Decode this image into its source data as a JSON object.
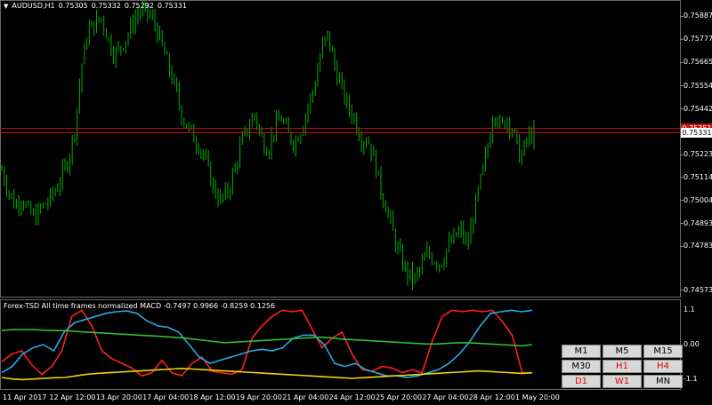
{
  "symbol": {
    "label": "AUDUSD,H1",
    "open": "0.75305",
    "high": "0.75332",
    "low": "0.75292",
    "close": "0.75331"
  },
  "indicator": {
    "label": "Forex-TSD All time frames normalized MACD -0.7497 0.9966 -0.8259 0.1256"
  },
  "price_axis": {
    "ticks": [
      "0.75887",
      "0.75777",
      "0.75665",
      "0.75554",
      "0.75442",
      "0.75223",
      "0.75114",
      "0.75004",
      "0.74893",
      "0.74783",
      "0.74573"
    ],
    "current_price": "0.75331",
    "ask_badge": "0.75351"
  },
  "indicator_axis": {
    "ticks": [
      "1.1",
      "0.00",
      "-1.1"
    ]
  },
  "time_axis": {
    "ticks": [
      "11 Apr 2017",
      "12 Apr 12:00",
      "13 Apr 20:00",
      "17 Apr 04:00",
      "18 Apr 12:00",
      "19 Apr 20:00",
      "21 Apr 04:00",
      "24 Apr 12:00",
      "25 Apr 20:00",
      "27 Apr 04:00",
      "28 Apr 12:00",
      "1 May 20:00"
    ]
  },
  "timeframes": [
    {
      "label": "M1",
      "active": false
    },
    {
      "label": "M5",
      "active": false
    },
    {
      "label": "M15",
      "active": false
    },
    {
      "label": "M30",
      "active": false
    },
    {
      "label": "H1",
      "active": true
    },
    {
      "label": "H4",
      "active": true
    },
    {
      "label": "D1",
      "active": true
    },
    {
      "label": "W1",
      "active": true
    },
    {
      "label": "MN",
      "active": false
    }
  ],
  "colors": {
    "candles": "#00b000",
    "bid_line": "#c01010",
    "macd_red": "#ff2020",
    "macd_blue": "#2aa8e8",
    "macd_green": "#30c030",
    "macd_yellow": "#f0d010"
  },
  "chart_data": {
    "type": "line",
    "price": {
      "series_name": "AUDUSD,H1",
      "ylim": [
        0.7455,
        0.7594
      ],
      "values": [
        0.7515,
        0.7505,
        0.7498,
        0.7502,
        0.7495,
        0.7492,
        0.7497,
        0.75,
        0.7505,
        0.7512,
        0.752,
        0.7535,
        0.7565,
        0.7582,
        0.7585,
        0.7588,
        0.7578,
        0.757,
        0.7575,
        0.758,
        0.7588,
        0.7592,
        0.759,
        0.7585,
        0.7575,
        0.7565,
        0.7555,
        0.7542,
        0.7535,
        0.753,
        0.7525,
        0.7515,
        0.7505,
        0.75,
        0.7505,
        0.7515,
        0.7528,
        0.7535,
        0.7542,
        0.753,
        0.7525,
        0.7535,
        0.754,
        0.7532,
        0.7528,
        0.7535,
        0.7545,
        0.7555,
        0.7572,
        0.758,
        0.7565,
        0.7555,
        0.7545,
        0.754,
        0.753,
        0.753,
        0.752,
        0.7505,
        0.7495,
        0.7482,
        0.7472,
        0.7465,
        0.7462,
        0.7468,
        0.7475,
        0.7472,
        0.747,
        0.7478,
        0.7482,
        0.7486,
        0.7478,
        0.7495,
        0.751,
        0.7525,
        0.7545,
        0.7535,
        0.754,
        0.7532,
        0.752,
        0.753,
        0.7533
      ],
      "current": 0.75331,
      "ask": 0.75351
    },
    "indicator": {
      "title": "Forex-TSD All time frames normalized MACD",
      "ylim": [
        -1.25,
        1.25
      ],
      "values_label": [
        -0.7497,
        0.9966,
        -0.8259,
        0.1256
      ],
      "series": [
        {
          "color": "red",
          "values": [
            -0.55,
            -0.3,
            -0.2,
            -0.65,
            -0.95,
            -0.7,
            -0.2,
            0.9,
            1.1,
            0.6,
            -0.2,
            -0.45,
            -0.6,
            -0.75,
            -1.0,
            -0.9,
            -0.5,
            -0.9,
            -1.0,
            -0.6,
            -0.4,
            -0.85,
            -0.9,
            -0.95,
            -0.8,
            0.2,
            0.6,
            0.9,
            1.1,
            1.05,
            1.1,
            0.5,
            -0.1,
            0.2,
            0.4,
            -0.3,
            -0.8,
            -0.85,
            -0.7,
            -0.75,
            -0.9,
            -0.8,
            -0.9,
            0.1,
            0.9,
            1.1,
            1.05,
            1.1,
            1.05,
            1.1,
            0.75,
            0.3,
            -0.9,
            -0.9
          ]
        },
        {
          "color": "blue",
          "values": [
            -0.9,
            -0.7,
            -0.3,
            -0.1,
            0.0,
            -0.2,
            0.4,
            0.7,
            0.8,
            0.9,
            1.0,
            1.05,
            1.08,
            1.0,
            0.75,
            0.6,
            0.55,
            0.4,
            0.0,
            -0.4,
            -0.6,
            -0.5,
            -0.4,
            -0.3,
            -0.2,
            -0.15,
            -0.2,
            -0.1,
            0.2,
            0.3,
            0.3,
            0.0,
            -0.6,
            -0.7,
            -0.6,
            -0.8,
            -0.9,
            -1.0,
            -1.0,
            -1.05,
            -1.0,
            -0.9,
            -0.8,
            -0.6,
            -0.3,
            0.1,
            0.6,
            1.0,
            1.05,
            1.1,
            1.05,
            1.1
          ]
        },
        {
          "color": "green",
          "values": [
            0.45,
            0.48,
            0.48,
            0.48,
            0.46,
            0.45,
            0.45,
            0.42,
            0.4,
            0.38,
            0.36,
            0.34,
            0.32,
            0.3,
            0.28,
            0.26,
            0.24,
            0.22,
            0.18,
            0.14,
            0.1,
            0.06,
            0.08,
            0.1,
            0.12,
            0.14,
            0.16,
            0.18,
            0.2,
            0.22,
            0.24,
            0.22,
            0.18,
            0.16,
            0.14,
            0.12,
            0.1,
            0.08,
            0.06,
            0.04,
            0.02,
            0.02,
            0.04,
            0.06,
            0.06,
            0.04,
            0.02,
            0.0,
            -0.02,
            -0.04,
            0.0
          ]
        },
        {
          "color": "yellow",
          "values": [
            -1.05,
            -1.1,
            -1.12,
            -1.1,
            -1.08,
            -1.06,
            -1.05,
            -1.0,
            -0.95,
            -0.92,
            -0.9,
            -0.88,
            -0.86,
            -0.84,
            -0.82,
            -0.8,
            -0.78,
            -0.76,
            -0.78,
            -0.8,
            -0.82,
            -0.84,
            -0.86,
            -0.88,
            -0.9,
            -0.92,
            -0.94,
            -0.96,
            -0.98,
            -1.0,
            -1.02,
            -1.04,
            -1.06,
            -1.08,
            -1.06,
            -1.04,
            -1.02,
            -1.0,
            -0.98,
            -0.96,
            -0.94,
            -0.92,
            -0.9,
            -0.88,
            -0.86,
            -0.84,
            -0.86,
            -0.88,
            -0.9,
            -0.92,
            -0.9
          ]
        }
      ]
    }
  }
}
